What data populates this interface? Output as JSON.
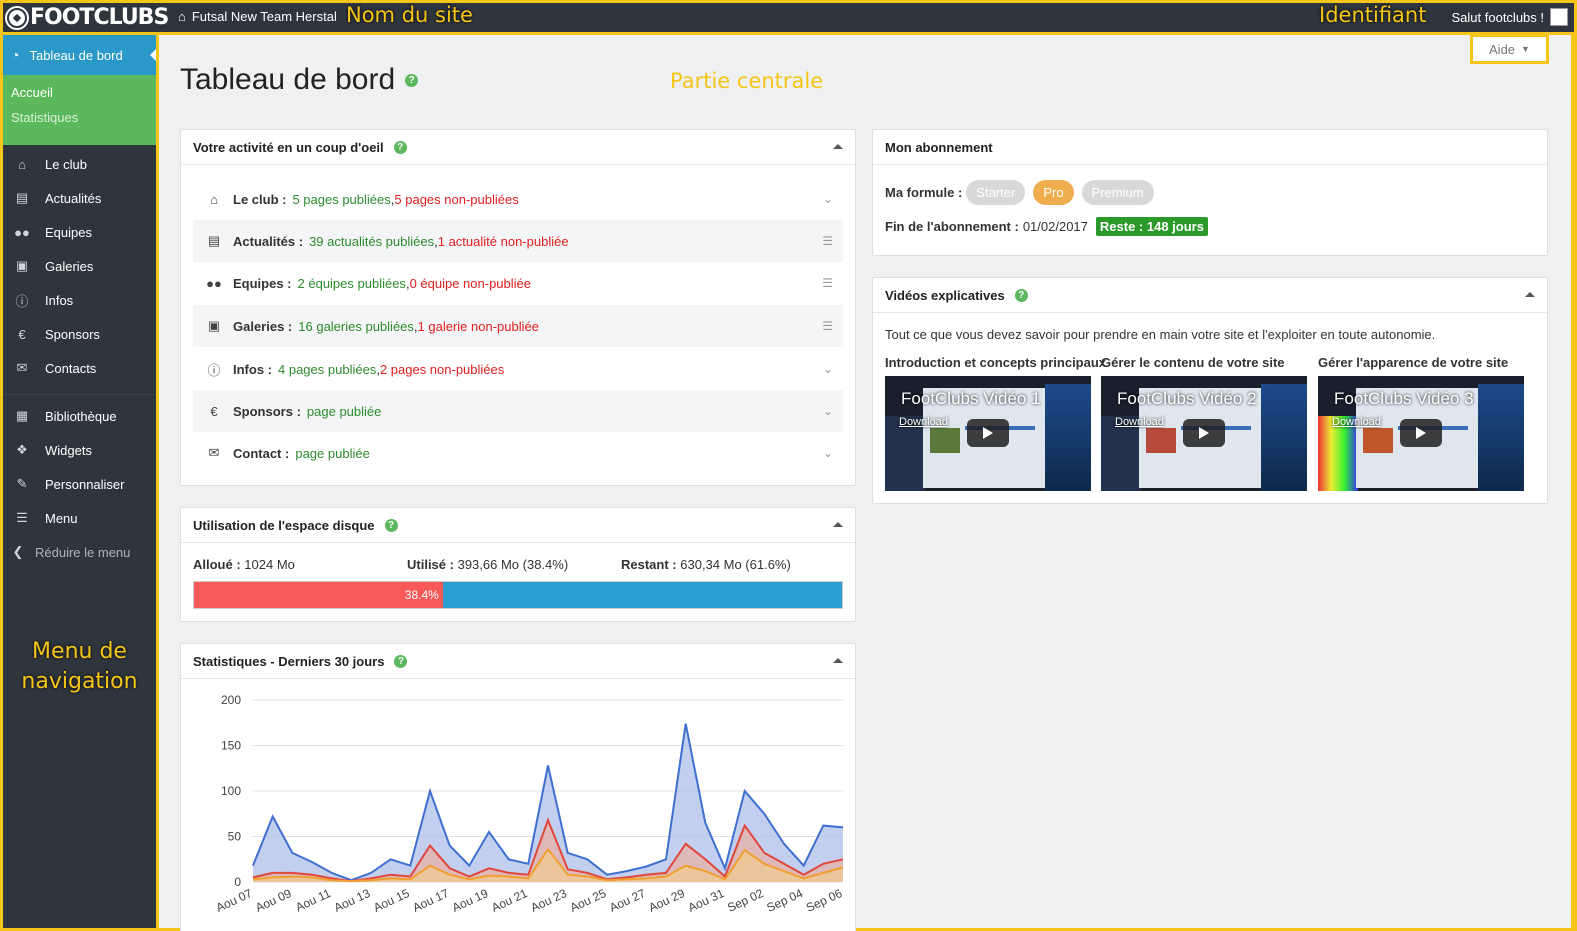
{
  "topbar": {
    "logo": "FOOTCLUBS",
    "site_name": "Futsal New Team Herstal",
    "annotation_site": "Nom du site",
    "annotation_user": "Identifiant",
    "greeting": "Salut footclubs !"
  },
  "sidebar": {
    "active": "Tableau de bord",
    "sub": [
      "Accueil",
      "Statistiques"
    ],
    "items": [
      {
        "label": "Le club",
        "icon": "home-icon"
      },
      {
        "label": "Actualités",
        "icon": "newspaper-icon"
      },
      {
        "label": "Equipes",
        "icon": "users-icon"
      },
      {
        "label": "Galeries",
        "icon": "camera-icon"
      },
      {
        "label": "Infos",
        "icon": "info-icon"
      },
      {
        "label": "Sponsors",
        "icon": "euro-icon"
      },
      {
        "label": "Contacts",
        "icon": "envelope-icon"
      }
    ],
    "items2": [
      {
        "label": "Bibliothèque",
        "icon": "library-icon"
      },
      {
        "label": "Widgets",
        "icon": "cubes-icon"
      },
      {
        "label": "Personnaliser",
        "icon": "brush-icon"
      },
      {
        "label": "Menu",
        "icon": "menu-icon"
      }
    ],
    "reduce": "Réduire le menu",
    "annotation": "Menu de navigation"
  },
  "main": {
    "title": "Tableau de bord",
    "help_button": "Aide",
    "annotation_center": "Partie centrale"
  },
  "activity": {
    "title": "Votre activité en un coup d'oeil",
    "rows": [
      {
        "label": "Le club :",
        "pub": "5 pages publiées",
        "sep": " , ",
        "unpub": "5 pages non-publiées",
        "icon": "home-icon",
        "tail": "chevron-down-icon"
      },
      {
        "label": "Actualités :",
        "pub": "39 actualités publiées",
        "sep": " , ",
        "unpub": "1 actualité non-publiée",
        "icon": "newspaper-icon",
        "tail": "list-icon"
      },
      {
        "label": "Equipes :",
        "pub": "2 équipes publiées",
        "sep": " , ",
        "unpub": "0 équipe non-publiée",
        "icon": "users-icon",
        "tail": "list-icon"
      },
      {
        "label": "Galeries :",
        "pub": "16 galeries publiées",
        "sep": " , ",
        "unpub": "1 galerie non-publiée",
        "icon": "camera-icon",
        "tail": "list-icon"
      },
      {
        "label": "Infos :",
        "pub": "4 pages publiées",
        "sep": " , ",
        "unpub": "2 pages non-publiées",
        "icon": "info-icon",
        "tail": "chevron-down-icon"
      },
      {
        "label": "Sponsors :",
        "pub": "page publiée",
        "sep": "",
        "unpub": "",
        "icon": "euro-icon",
        "tail": "chevron-down-icon"
      },
      {
        "label": "Contact :",
        "pub": "page publiée",
        "sep": "",
        "unpub": "",
        "icon": "envelope-icon",
        "tail": "chevron-down-icon"
      }
    ]
  },
  "disk": {
    "title": "Utilisation de l'espace disque",
    "alloue_label": "Alloué :",
    "alloue": "1024 Mo",
    "utilise_label": "Utilisé :",
    "utilise": "393,66 Mo (38.4%)",
    "restant_label": "Restant :",
    "restant": "630,34 Mo (61.6%)",
    "bar_label": "38.4%",
    "used_fraction": 0.384
  },
  "stats": {
    "title": "Statistiques - Derniers 30 jours"
  },
  "chart_data": {
    "type": "area",
    "title": "Statistiques - Derniers 30 jours",
    "xlabel": "",
    "ylabel": "",
    "ylim": [
      0,
      200
    ],
    "yticks": [
      "200",
      "150",
      "100",
      "50",
      "0"
    ],
    "x_tick_labels": [
      "Aou 07",
      "Aou 09",
      "Aou 11",
      "Aou 13",
      "Aou 15",
      "Aou 17",
      "Aou 19",
      "Aou 21",
      "Aou 23",
      "Aou 25",
      "Aou 27",
      "Aou 29",
      "Aou 31",
      "Sep 02",
      "Sep 04",
      "Sep 06"
    ],
    "series": [
      {
        "color": "#3f6fd0",
        "fill": "#aebfe8",
        "values": [
          18,
          72,
          32,
          22,
          10,
          2,
          10,
          25,
          18,
          100,
          40,
          18,
          55,
          25,
          20,
          128,
          32,
          25,
          8,
          12,
          17,
          25,
          174,
          65,
          15,
          100,
          75,
          42,
          18,
          62,
          60
        ]
      },
      {
        "color": "#e0473b",
        "fill": "#e8b0a8",
        "values": [
          5,
          10,
          10,
          8,
          4,
          1,
          4,
          8,
          6,
          40,
          15,
          6,
          15,
          10,
          8,
          68,
          14,
          10,
          3,
          5,
          8,
          10,
          42,
          25,
          6,
          62,
          32,
          20,
          8,
          20,
          25
        ]
      },
      {
        "color": "#f0a030",
        "fill": "#f2c98f",
        "values": [
          3,
          5,
          6,
          5,
          2,
          1,
          2,
          4,
          3,
          18,
          8,
          3,
          7,
          6,
          4,
          36,
          8,
          6,
          2,
          3,
          4,
          6,
          18,
          12,
          3,
          35,
          20,
          12,
          4,
          10,
          16
        ]
      }
    ],
    "grid": true
  },
  "subscription": {
    "title": "Mon abonnement",
    "formule_label": "Ma formule :",
    "plans": [
      "Starter",
      "Pro",
      "Premium"
    ],
    "active_plan": "Pro",
    "end_label": "Fin de l'abonnement :",
    "end_date": "01/02/2017",
    "remaining": "Reste : 148 jours",
    "colors": {
      "active": "#f0ad4e",
      "inactive": "#d8d8d8",
      "remaining": "#2b9a2b"
    }
  },
  "videos": {
    "title": "Vidéos explicatives",
    "intro": "Tout ce que vous devez savoir pour prendre en main votre site et l'exploiter en toute autonomie.",
    "items": [
      {
        "label": "Introduction et concepts principaux",
        "title": "FootClubs Vidéo 1",
        "download": "Download"
      },
      {
        "label": "Gérer le contenu de votre site",
        "title": "FootClubs Vidéo 2",
        "download": "Download"
      },
      {
        "label": "Gérer l'apparence de votre site",
        "title": "FootClubs Vidéo 3",
        "download": "Download"
      }
    ]
  }
}
